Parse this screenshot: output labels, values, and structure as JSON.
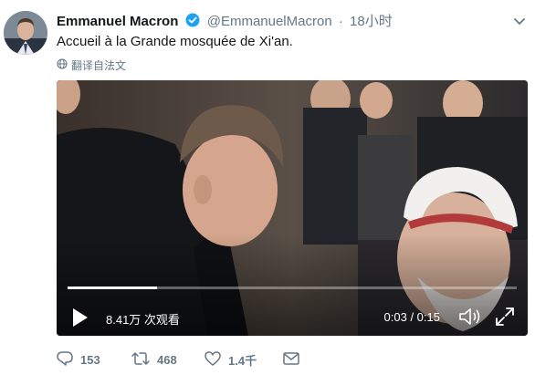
{
  "tweet": {
    "author_name": "Emmanuel Macron",
    "handle": "@EmmanuelMacron",
    "separator": "·",
    "time": "18小时",
    "text": "Accueil à la Grande mosquée de Xi'an.",
    "translate_label": "翻译自法文"
  },
  "video": {
    "views": "8.41万 次观看",
    "timecode": "0:03 / 0:15",
    "progress_fraction": 0.2
  },
  "actions": {
    "reply_count": "153",
    "retweet_count": "468",
    "like_count": "1.4千"
  },
  "colors": {
    "verified": "#1da1f2",
    "secondary_text": "#657786"
  }
}
